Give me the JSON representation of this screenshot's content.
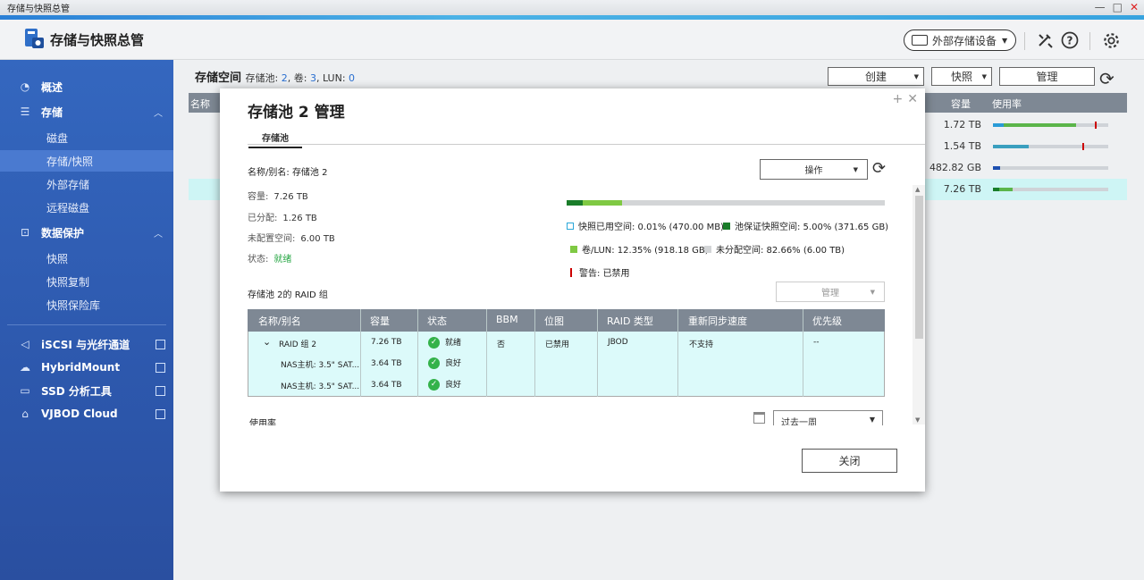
{
  "window": {
    "title": "存储与快照总管"
  },
  "header": {
    "app_title": "存储与快照总管",
    "external_storage": "外部存储设备"
  },
  "sidebar": {
    "items": [
      {
        "label": "概述"
      },
      {
        "label": "存储"
      },
      {
        "label": "磁盘"
      },
      {
        "label": "存储/快照"
      },
      {
        "label": "外部存储"
      },
      {
        "label": "远程磁盘"
      },
      {
        "label": "数据保护"
      },
      {
        "label": "快照"
      },
      {
        "label": "快照复制"
      },
      {
        "label": "快照保险库"
      },
      {
        "label": "iSCSI 与光纤通道"
      },
      {
        "label": "HybridMount"
      },
      {
        "label": "SSD 分析工具"
      },
      {
        "label": "VJBOD Cloud"
      }
    ]
  },
  "main": {
    "title": "存储空间",
    "meta_prefix_pool": "存储池:",
    "meta_pool": "2",
    "meta_prefix_vol": ", 卷:",
    "meta_vol": "3",
    "meta_prefix_lun": ", LUN:",
    "meta_lun": "0",
    "btn_create": "创建",
    "btn_snapshot": "快照",
    "btn_manage": "管理",
    "col_name": "名称",
    "col_capacity": "容量",
    "col_usage": "使用率",
    "rows": [
      {
        "capacity": "1.72 TB"
      },
      {
        "capacity": "1.54 TB"
      },
      {
        "capacity": "482.82 GB"
      },
      {
        "capacity": "7.26 TB"
      }
    ]
  },
  "modal": {
    "title": "存储池 2 管理",
    "tab": "存储池",
    "name_label": "名称/别名:",
    "name_value": "存储池 2",
    "capacity_label": "容量:",
    "capacity_value": "7.26 TB",
    "allocated_label": "已分配:",
    "allocated_value": "1.26 TB",
    "unconfigured_label": "未配置空间:",
    "unconfigured_value": "6.00 TB",
    "status_label": "状态:",
    "status_value": "就绪",
    "operate_btn": "操作",
    "usage_bar": {
      "snapshot_used_pct": 0.01,
      "snapshot_guarantee_pct": 5.0,
      "volume_lun_pct": 12.35,
      "unallocated_pct": 82.66
    },
    "legend": {
      "snap_used": "快照已用空间: 0.01% (470.00 MB)",
      "snap_guarantee": "池保证快照空间: 5.00% (371.65 GB)",
      "volume_lun": "卷/LUN: 12.35% (918.18 GB)",
      "unallocated": "未分配空间: 82.66% (6.00 TB)",
      "warning": "警告: 已禁用"
    },
    "raid_label": "存储池 2的 RAID 组",
    "manage_btn": "管理",
    "table": {
      "headers": [
        "名称/别名",
        "容量",
        "状态",
        "BBM",
        "位图",
        "RAID 类型",
        "重新同步速度",
        "优先级"
      ],
      "rows": [
        {
          "name": "RAID 组 2",
          "capacity": "7.26 TB",
          "status": "就绪",
          "bbm": "否",
          "bitmap": "已禁用",
          "raid_type": "JBOD",
          "resync": "不支持",
          "priority": "--"
        },
        {
          "name": "NAS主机: 3.5\" SAT...",
          "capacity": "3.64 TB",
          "status": "良好"
        },
        {
          "name": "NAS主机: 3.5\" SAT...",
          "capacity": "3.64 TB",
          "status": "良好"
        }
      ]
    },
    "usage_label": "使用率",
    "period": "过去一周",
    "close_btn": "关闭"
  },
  "colors": {
    "accent": "#2a7fd6",
    "sidebar": "#2d58ad",
    "ok": "#34b24a",
    "table_head": "#7e8894",
    "row_bg": "#dcfafa"
  }
}
